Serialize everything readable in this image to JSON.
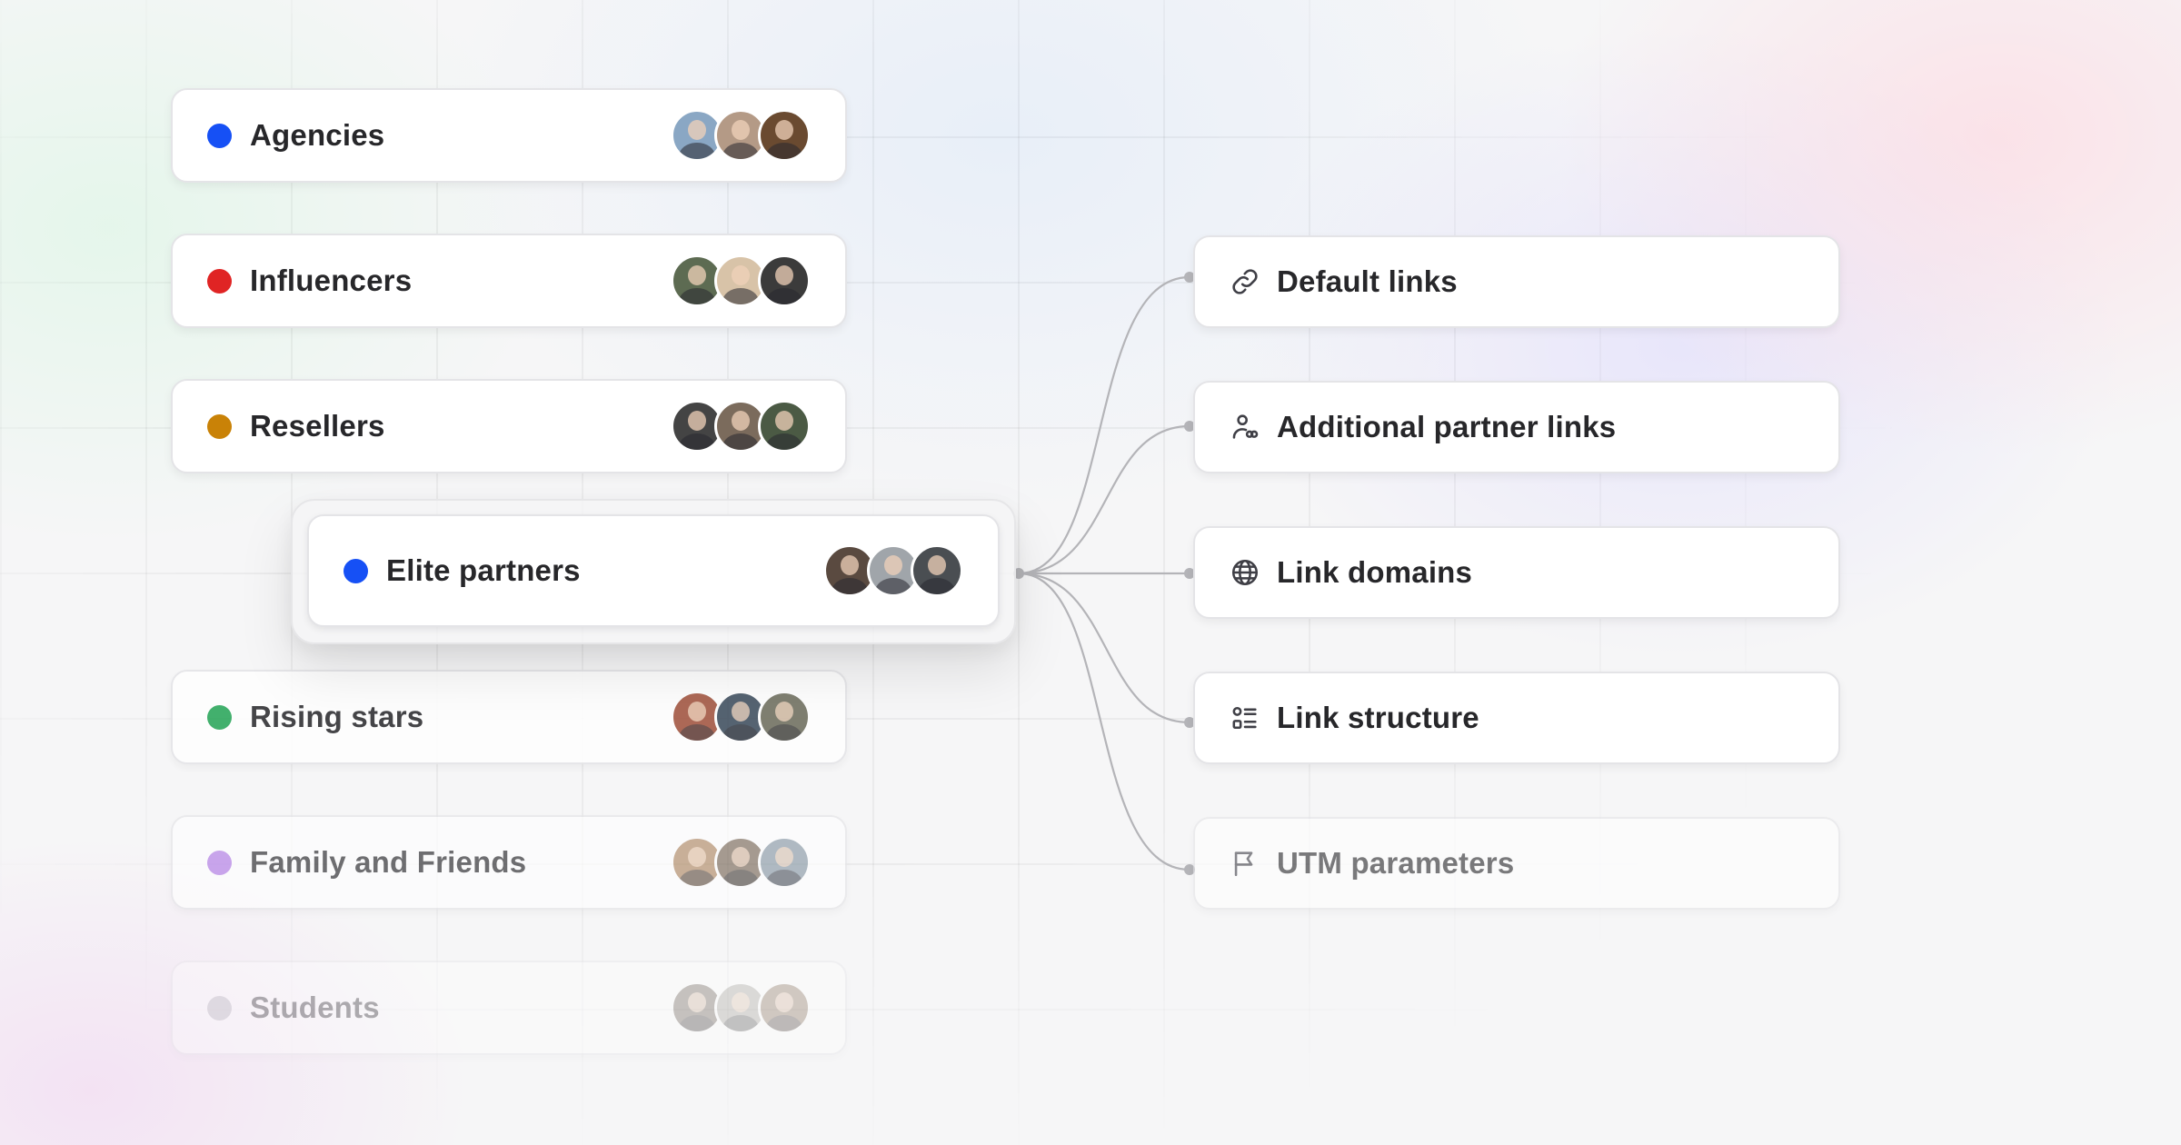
{
  "colors": {
    "agencies": "#1650f5",
    "influencers": "#e02424",
    "resellers": "#c98207",
    "elite_partners": "#1650f5",
    "rising_stars": "#23a455",
    "family_and_friends": "#b07ae6",
    "students": "#b8b8bd",
    "connector": "#b4b4b8"
  },
  "groups": [
    {
      "label": "Agencies",
      "avatars": [
        "#8aa7c4",
        "#b49a86",
        "#6a4a30"
      ]
    },
    {
      "label": "Influencers",
      "avatars": [
        "#5d6b52",
        "#d8c3a8",
        "#3b3b3b"
      ]
    },
    {
      "label": "Resellers",
      "avatars": [
        "#444444",
        "#7b6b5c",
        "#4b5a44"
      ]
    },
    {
      "label": "Rising stars",
      "avatars": [
        "#a0503a",
        "#3a4a5a",
        "#6b6b5a"
      ]
    },
    {
      "label": "Family and Friends",
      "avatars": [
        "#b08a66",
        "#7a6a5a",
        "#8a9aa6"
      ]
    },
    {
      "label": "Students",
      "avatars": [
        "#6b6055",
        "#a8a49c",
        "#8c7560"
      ]
    }
  ],
  "selected_group": {
    "label": "Elite partners",
    "avatars": [
      "#5a4a40",
      "#a0a5aa",
      "#4a4e52"
    ]
  },
  "links": [
    {
      "label": "Default links",
      "icon": "link-icon"
    },
    {
      "label": "Additional partner links",
      "icon": "user-link-icon"
    },
    {
      "label": "Link domains",
      "icon": "globe-icon"
    },
    {
      "label": "Link structure",
      "icon": "list-structure-icon"
    },
    {
      "label": "UTM parameters",
      "icon": "flag-icon"
    }
  ]
}
